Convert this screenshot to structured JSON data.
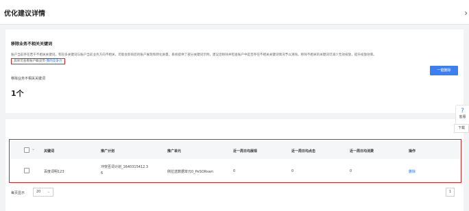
{
  "header": {
    "title": "优化建议详情",
    "close_icon": "›"
  },
  "section": {
    "title": "移除业务不相关关键词",
    "description": "账户当前存在若干不相关关键词，有较多关键词与账户当前业务方向不相关，可能会影响您的账户展现和转化质量。系统提供了部分关键词示例，建议您移除并检查账户中是否存在不相关关键词情况予以清除。移除不相关的关键词可减少无效投放，提升投放效率。",
    "highlight_prefix": "具体可查看账户概览页-",
    "highlight_link": "我的竞争力",
    "metric_label": "移除业务不相关关键词",
    "metric_value": "1个",
    "delete_all_button": "一键删除"
  },
  "floating_tab": {
    "icon": "?",
    "label": "客服"
  },
  "download_button": "下载",
  "table": {
    "columns": [
      "关键词",
      "推广计划",
      "推广单元",
      "近一周日均展现",
      "近一周日均点击",
      "近一周日均消费",
      "操作"
    ],
    "rows": [
      {
        "keyword": "百度词明123",
        "plan_line1": "冲突否词计划_1640315412.3",
        "plan_line2": "6",
        "unit": "侧拉选数据单元0_PeSORswn",
        "impressions": "0",
        "clicks": "0",
        "cost": "0",
        "action": "删除"
      }
    ]
  },
  "pagination": {
    "per_page_label": "每页显示",
    "page_size": "20",
    "current_page": "1"
  },
  "colors": {
    "accent": "#3b7ff0",
    "highlight_border": "#e02020",
    "link": "#1a73e8"
  }
}
